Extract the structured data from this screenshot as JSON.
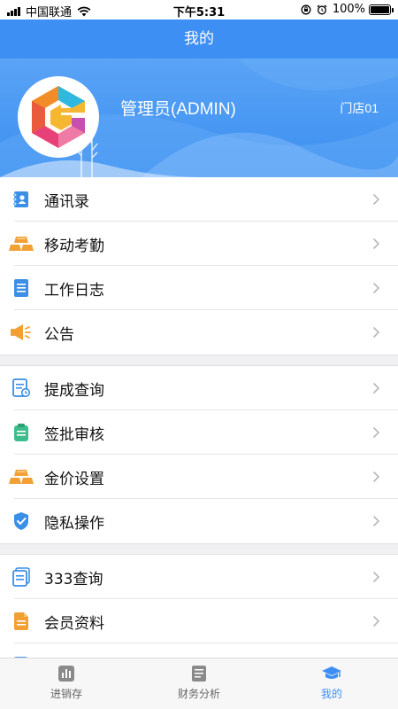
{
  "status_bar": {
    "carrier": "中国联通",
    "time": "下午5:31",
    "battery_text": "100%",
    "battery_level": 1.0
  },
  "nav": {
    "title": "我的"
  },
  "profile": {
    "name": "管理员(ADMIN)",
    "store": "门店01"
  },
  "menu": {
    "group1": [
      {
        "label": "通讯录",
        "icon": "contacts-icon"
      },
      {
        "label": "移动考勤",
        "icon": "gold-bars-icon"
      },
      {
        "label": "工作日志",
        "icon": "work-log-icon"
      },
      {
        "label": "公告",
        "icon": "megaphone-icon"
      }
    ],
    "group2": [
      {
        "label": "提成查询",
        "icon": "commission-doc-icon"
      },
      {
        "label": "签批审核",
        "icon": "clipboard-icon"
      },
      {
        "label": "金价设置",
        "icon": "gold-bars-icon"
      },
      {
        "label": "隐私操作",
        "icon": "shield-check-icon"
      }
    ],
    "group3": [
      {
        "label": "333查询",
        "icon": "docs-icon"
      },
      {
        "label": "会员资料",
        "icon": "member-doc-icon"
      }
    ]
  },
  "tabs": [
    {
      "label": "进销存",
      "icon": "inventory-chart-icon",
      "active": false
    },
    {
      "label": "财务分析",
      "icon": "finance-doc-icon",
      "active": false
    },
    {
      "label": "我的",
      "icon": "graduation-cap-icon",
      "active": true
    }
  ],
  "colors": {
    "primary": "#3d8ff3",
    "gold": "#f2a033",
    "icon_blue": "#3b8fe6",
    "icon_green": "#3dbd8c"
  }
}
